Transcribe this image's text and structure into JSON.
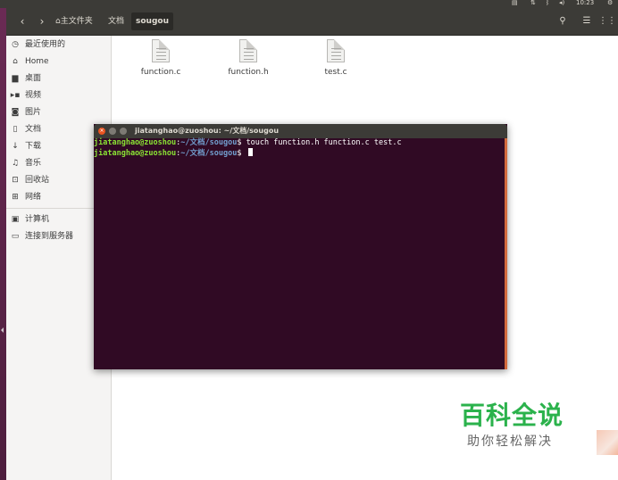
{
  "system": {
    "clock": "10:23",
    "indicators": [
      "keyboard-icon",
      "network-icon",
      "bluetooth-icon",
      "volume-icon",
      "power-icon"
    ]
  },
  "nav": {
    "back_icon": "‹",
    "forward_icon": "›",
    "breadcrumbs": [
      {
        "label": "主文件夹",
        "icon": "home-icon"
      },
      {
        "label": "文档"
      },
      {
        "label": "sougou",
        "active": true
      }
    ]
  },
  "header_icons": {
    "search": "search-icon",
    "list_view": "list-view-icon",
    "grid_view": "grid-view-icon"
  },
  "sidebar": {
    "places": [
      {
        "label": "最近使用的",
        "icon": "recent-icon"
      },
      {
        "label": "Home",
        "icon": "home-icon"
      },
      {
        "label": "桌面",
        "icon": "desktop-icon"
      },
      {
        "label": "视频",
        "icon": "video-icon"
      },
      {
        "label": "图片",
        "icon": "camera-icon"
      },
      {
        "label": "文档",
        "icon": "document-icon"
      },
      {
        "label": "下载",
        "icon": "download-icon"
      },
      {
        "label": "音乐",
        "icon": "music-icon"
      },
      {
        "label": "回收站",
        "icon": "trash-icon"
      },
      {
        "label": "网络",
        "icon": "network-icon"
      }
    ],
    "devices": [
      {
        "label": "计算机",
        "icon": "computer-icon"
      },
      {
        "label": "连接到服务器",
        "icon": "server-icon"
      }
    ]
  },
  "files": [
    {
      "name": "function.c"
    },
    {
      "name": "function.h"
    },
    {
      "name": "test.c"
    }
  ],
  "terminal": {
    "title": "jiatanghao@zuoshou: ~/文档/sougou",
    "lines": [
      {
        "user": "jiatanghao@zuoshou",
        "sep": ":",
        "path": "~/文档/sougou",
        "prompt": "$ ",
        "command": "touch function.h function.c test.c"
      },
      {
        "user": "jiatanghao@zuoshou",
        "sep": ":",
        "path": "~/文档/sougou",
        "prompt": "$ ",
        "command": ""
      }
    ]
  },
  "watermark": {
    "title": "百科全说",
    "subtitle": "助你轻松解决"
  },
  "colors": {
    "terminal_bg": "#300a24",
    "prompt_user": "#8ae234",
    "prompt_path": "#729fcf",
    "titlebar": "#3c3b37",
    "close_button": "#e95420",
    "watermark_green": "#2bb24c"
  }
}
